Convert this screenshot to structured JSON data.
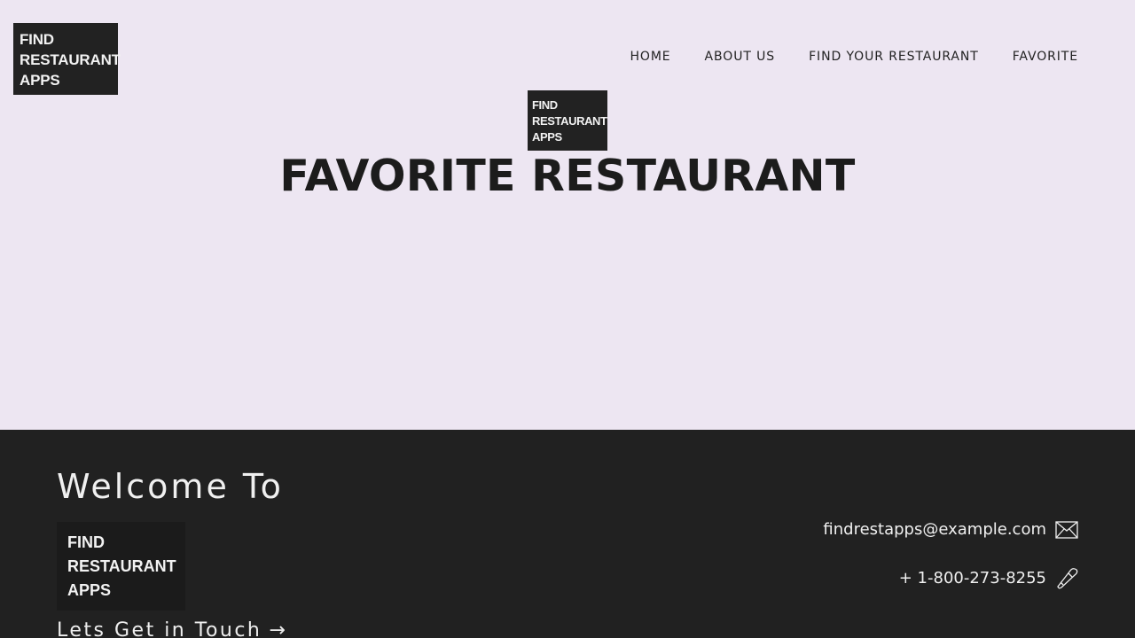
{
  "header": {
    "logo": [
      "FIND",
      "RESTAURANT",
      "APPS"
    ],
    "nav": [
      "HOME",
      "ABOUT US",
      "FIND YOUR RESTAURANT",
      "FAVORITE"
    ]
  },
  "hero": {
    "logo": [
      "FIND",
      "RESTAURANT",
      "APPS"
    ],
    "title": "FAVORITE RESTAURANT"
  },
  "footer": {
    "welcome": "Welcome To",
    "logo": [
      "FIND",
      "RESTAURANT",
      "APPS"
    ],
    "cta": "Lets Get in Touch",
    "email": "findrestapps@example.com",
    "phone": "+ 1-800-273-8255",
    "icons": {
      "email": "envelope-icon",
      "phone": "phone-icon",
      "cta": "arrow-right-icon"
    }
  },
  "colors": {
    "page_background": "#ede6f2",
    "dark": "#212121",
    "text_dark": "#1c1c1c",
    "text_light": "#f0f0f0"
  }
}
